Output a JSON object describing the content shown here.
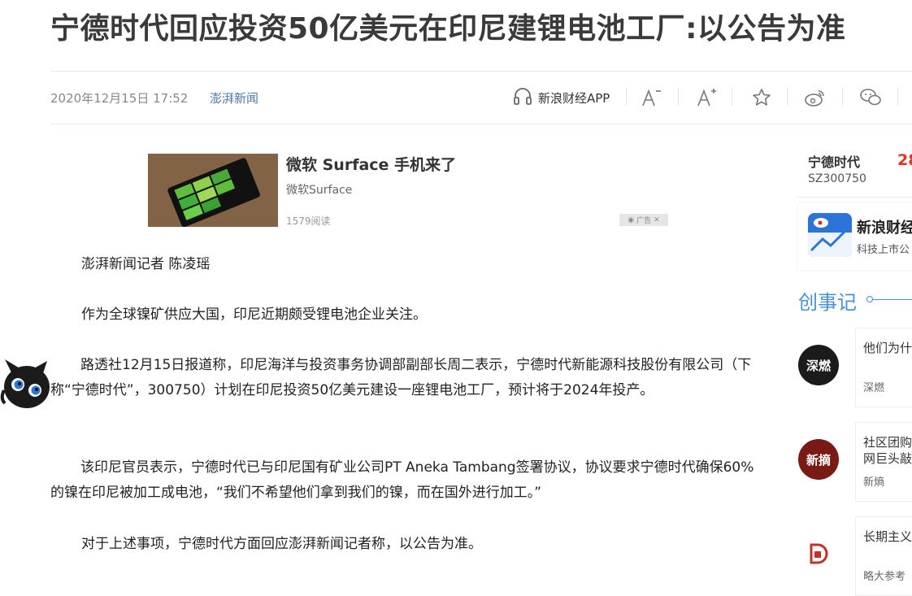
{
  "article": {
    "title": "宁德时代回应投资50亿美元在印尼建锂电池工厂:以公告为准",
    "date": "2020年12月15日 17:52",
    "source": "澎湃新闻",
    "paragraphs": [
      "澎湃新闻记者 陈凌瑶",
      "作为全球镍矿供应大国，印尼近期颇受锂电池企业关注。",
      "路透社12月15日报道称，印尼海洋与投资事务协调部副部长周二表示，宁德时代新能源科技股份有限公司（下称“宁德时代”，300750）计划在印尼投资50亿美元建设一座锂电池工厂，预计将于2024年投产。",
      "该印尼官员表示，宁德时代已与印尼国有矿业公司PT Aneka Tambang签署协议，协议要求宁德时代确保60%的镍在印尼被加工成电池，“我们不希望他们拿到我们的镍，而在国外进行加工。”",
      "对于上述事项，宁德时代方面回应澎湃新闻记者称，以公告为准。"
    ]
  },
  "toolbar": {
    "app_label": "新浪财经APP",
    "icons": [
      "headphones-icon",
      "font-decrease-icon",
      "font-increase-icon",
      "star-icon",
      "weibo-icon",
      "wechat-icon"
    ]
  },
  "ad": {
    "title": "微软 Surface 手机来了",
    "subtitle": "微软Surface",
    "reads": "1579阅读",
    "badge": "广告"
  },
  "sidebar": {
    "stock": {
      "name": "宁德时代",
      "code": "SZ300750",
      "price": "28"
    },
    "sina": {
      "name": "新浪财经",
      "desc": "科技上市公"
    },
    "section_title": "创事记",
    "feed": [
      {
        "avatar_text": "深燃",
        "title": "他们为什",
        "source": "深燃",
        "color": "#1b1b1b"
      },
      {
        "avatar_text": "新摘",
        "title": "社区团购",
        "title2": "网巨头敲",
        "source": "新熵",
        "color": "#7a1a14"
      },
      {
        "avatar_text": "",
        "title": "长期主义",
        "source": "略大参考",
        "color": "#ffffff"
      }
    ]
  },
  "colors": {
    "accent_blue": "#4a90d9",
    "source_link": "#4a78a8",
    "price_red": "#e0352b"
  }
}
